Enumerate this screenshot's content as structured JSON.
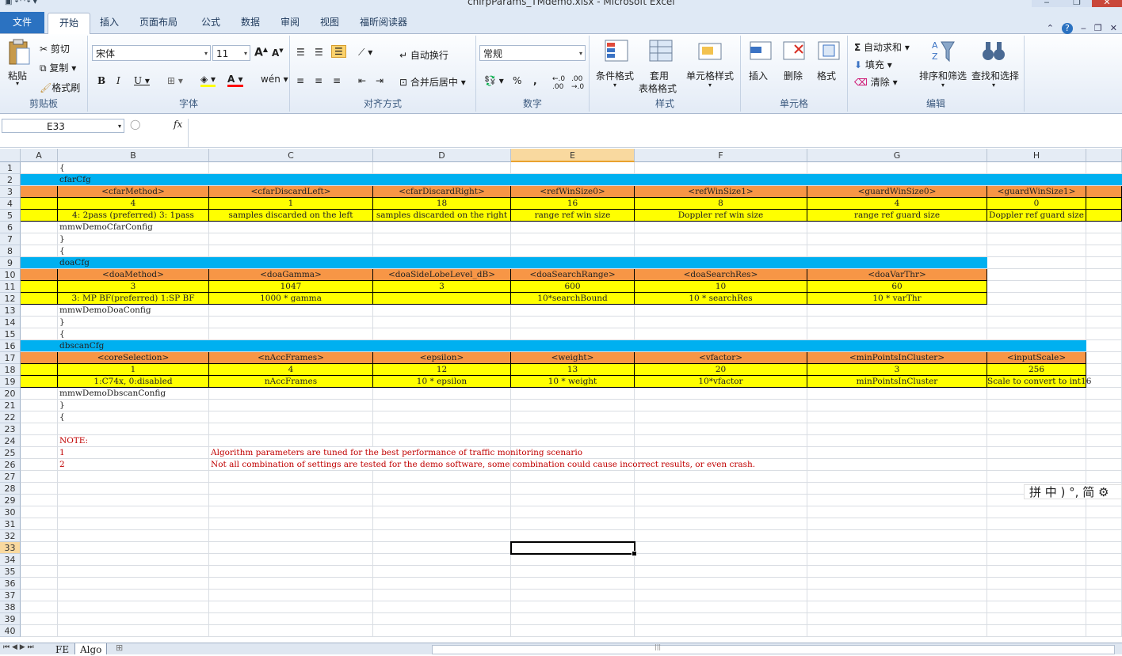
{
  "window": {
    "title": "chirpParams_TMdemo.xlsx - Microsoft Excel"
  },
  "tabs": {
    "file": "文件",
    "items": [
      "开始",
      "插入",
      "页面布局",
      "公式",
      "数据",
      "审阅",
      "视图",
      "福昕阅读器"
    ]
  },
  "ribbon": {
    "clipboard": {
      "paste": "粘贴",
      "cut": "剪切",
      "copy": "复制",
      "format_painter": "格式刷",
      "label": "剪贴板"
    },
    "font": {
      "name": "宋体",
      "size": "11",
      "label": "字体"
    },
    "alignment": {
      "wrap": "自动换行",
      "merge": "合并后居中",
      "label": "对齐方式"
    },
    "number": {
      "format": "常规",
      "label": "数字"
    },
    "styles": {
      "conditional": "条件格式",
      "table_1": "套用",
      "table_2": "表格格式",
      "cell_styles": "单元格样式",
      "label": "样式"
    },
    "cells": {
      "insert": "插入",
      "delete": "删除",
      "format": "格式",
      "label": "单元格"
    },
    "editing": {
      "autosum": "自动求和",
      "fill": "填充",
      "clear": "清除",
      "sort": "排序和筛选",
      "find": "查找和选择",
      "label": "编辑"
    }
  },
  "formula_bar": {
    "name_box": "E33",
    "fx": "fx",
    "value": ""
  },
  "columns": [
    "A",
    "B",
    "C",
    "D",
    "E",
    "F",
    "G",
    "H"
  ],
  "selected": {
    "column": "E",
    "row": "33"
  },
  "rows": [
    {
      "n": "1",
      "cells": [
        "",
        "{"
      ]
    },
    {
      "n": "2",
      "cells": [
        "",
        "cfarCfg"
      ]
    },
    {
      "n": "3",
      "cells": [
        "",
        "<cfarMethod>",
        "<cfarDiscardLeft>",
        "<cfarDiscardRight>",
        "<refWinSize0>",
        "<refWinSize1>",
        "<guardWinSize0>",
        "<guardWinSize1>"
      ]
    },
    {
      "n": "4",
      "cells": [
        "",
        "4",
        "1",
        "18",
        "16",
        "8",
        "4",
        "0"
      ]
    },
    {
      "n": "5",
      "cells": [
        "",
        "4: 2pass (preferred) 3: 1pass",
        "samples discarded on the left",
        "samples discarded on the right",
        "range ref win size",
        "Doppler ref win size",
        "range ref guard size",
        "Doppler ref guard size"
      ]
    },
    {
      "n": "6",
      "cells": [
        "",
        "mmwDemoCfarConfig"
      ]
    },
    {
      "n": "7",
      "cells": [
        "",
        "}"
      ]
    },
    {
      "n": "8",
      "cells": [
        "",
        "{"
      ]
    },
    {
      "n": "9",
      "cells": [
        "",
        "doaCfg"
      ]
    },
    {
      "n": "10",
      "cells": [
        "",
        "<doaMethod>",
        "<doaGamma>",
        "<doaSideLobeLevel_dB>",
        "<doaSearchRange>",
        "<doaSearchRes>",
        "<doaVarThr>"
      ]
    },
    {
      "n": "11",
      "cells": [
        "",
        "3",
        "1047",
        "3",
        "600",
        "10",
        "60"
      ]
    },
    {
      "n": "12",
      "cells": [
        "",
        "3: MP BF(preferred) 1:SP BF",
        "1000 * gamma",
        "",
        "10*searchBound",
        "10 * searchRes",
        "10 * varThr"
      ]
    },
    {
      "n": "13",
      "cells": [
        "",
        "mmwDemoDoaConfig"
      ]
    },
    {
      "n": "14",
      "cells": [
        "",
        "}"
      ]
    },
    {
      "n": "15",
      "cells": [
        "",
        "{"
      ]
    },
    {
      "n": "16",
      "cells": [
        "",
        "dbscanCfg"
      ]
    },
    {
      "n": "17",
      "cells": [
        "",
        "<coreSelection>",
        "<nAccFrames>",
        "<epsilon>",
        "<weight>",
        "<vfactor>",
        "<minPointsInCluster>",
        "<inputScale>"
      ]
    },
    {
      "n": "18",
      "cells": [
        "",
        "1",
        "4",
        "12",
        "13",
        "20",
        "3",
        "256"
      ]
    },
    {
      "n": "19",
      "cells": [
        "",
        "1:C74x,  0:disabled",
        "nAccFrames",
        "10 * epsilon",
        "10 * weight",
        "10*vfactor",
        "minPointsInCluster",
        "Scale to convert to int16"
      ]
    },
    {
      "n": "20",
      "cells": [
        "",
        "mmwDemoDbscanConfig"
      ]
    },
    {
      "n": "21",
      "cells": [
        "",
        "}"
      ]
    },
    {
      "n": "22",
      "cells": [
        "",
        "{"
      ]
    },
    {
      "n": "23",
      "cells": [
        ""
      ]
    },
    {
      "n": "24",
      "cells": [
        "",
        "NOTE:"
      ]
    },
    {
      "n": "25",
      "cells": [
        "",
        "1",
        "Algorithm parameters are tuned for the best performance of traffic monitoring scenario"
      ]
    },
    {
      "n": "26",
      "cells": [
        "",
        "2",
        "Not all combination of settings are tested for the demo software, some combination could cause incorrect results, or even crash."
      ]
    },
    {
      "n": "27",
      "cells": [
        ""
      ]
    },
    {
      "n": "28",
      "cells": [
        ""
      ]
    },
    {
      "n": "29",
      "cells": [
        ""
      ]
    },
    {
      "n": "30",
      "cells": [
        ""
      ]
    },
    {
      "n": "31",
      "cells": [
        ""
      ]
    },
    {
      "n": "32",
      "cells": [
        ""
      ]
    },
    {
      "n": "33",
      "cells": [
        ""
      ]
    },
    {
      "n": "34",
      "cells": [
        ""
      ]
    },
    {
      "n": "35",
      "cells": [
        ""
      ]
    },
    {
      "n": "36",
      "cells": [
        ""
      ]
    },
    {
      "n": "37",
      "cells": [
        ""
      ]
    },
    {
      "n": "38",
      "cells": [
        ""
      ]
    },
    {
      "n": "39",
      "cells": [
        ""
      ]
    },
    {
      "n": "40",
      "cells": [
        ""
      ]
    }
  ],
  "sheets": [
    {
      "name": "FE",
      "active": false
    },
    {
      "name": "Algo",
      "active": true
    }
  ],
  "ime": {
    "text": "拼 中 ) °, 简 ⚙"
  },
  "colors": {
    "cyan": "#00b0f0",
    "orange": "#f79646",
    "yellow": "#ffff00",
    "accent": "#2b72c1",
    "note_red": "#c00000"
  }
}
